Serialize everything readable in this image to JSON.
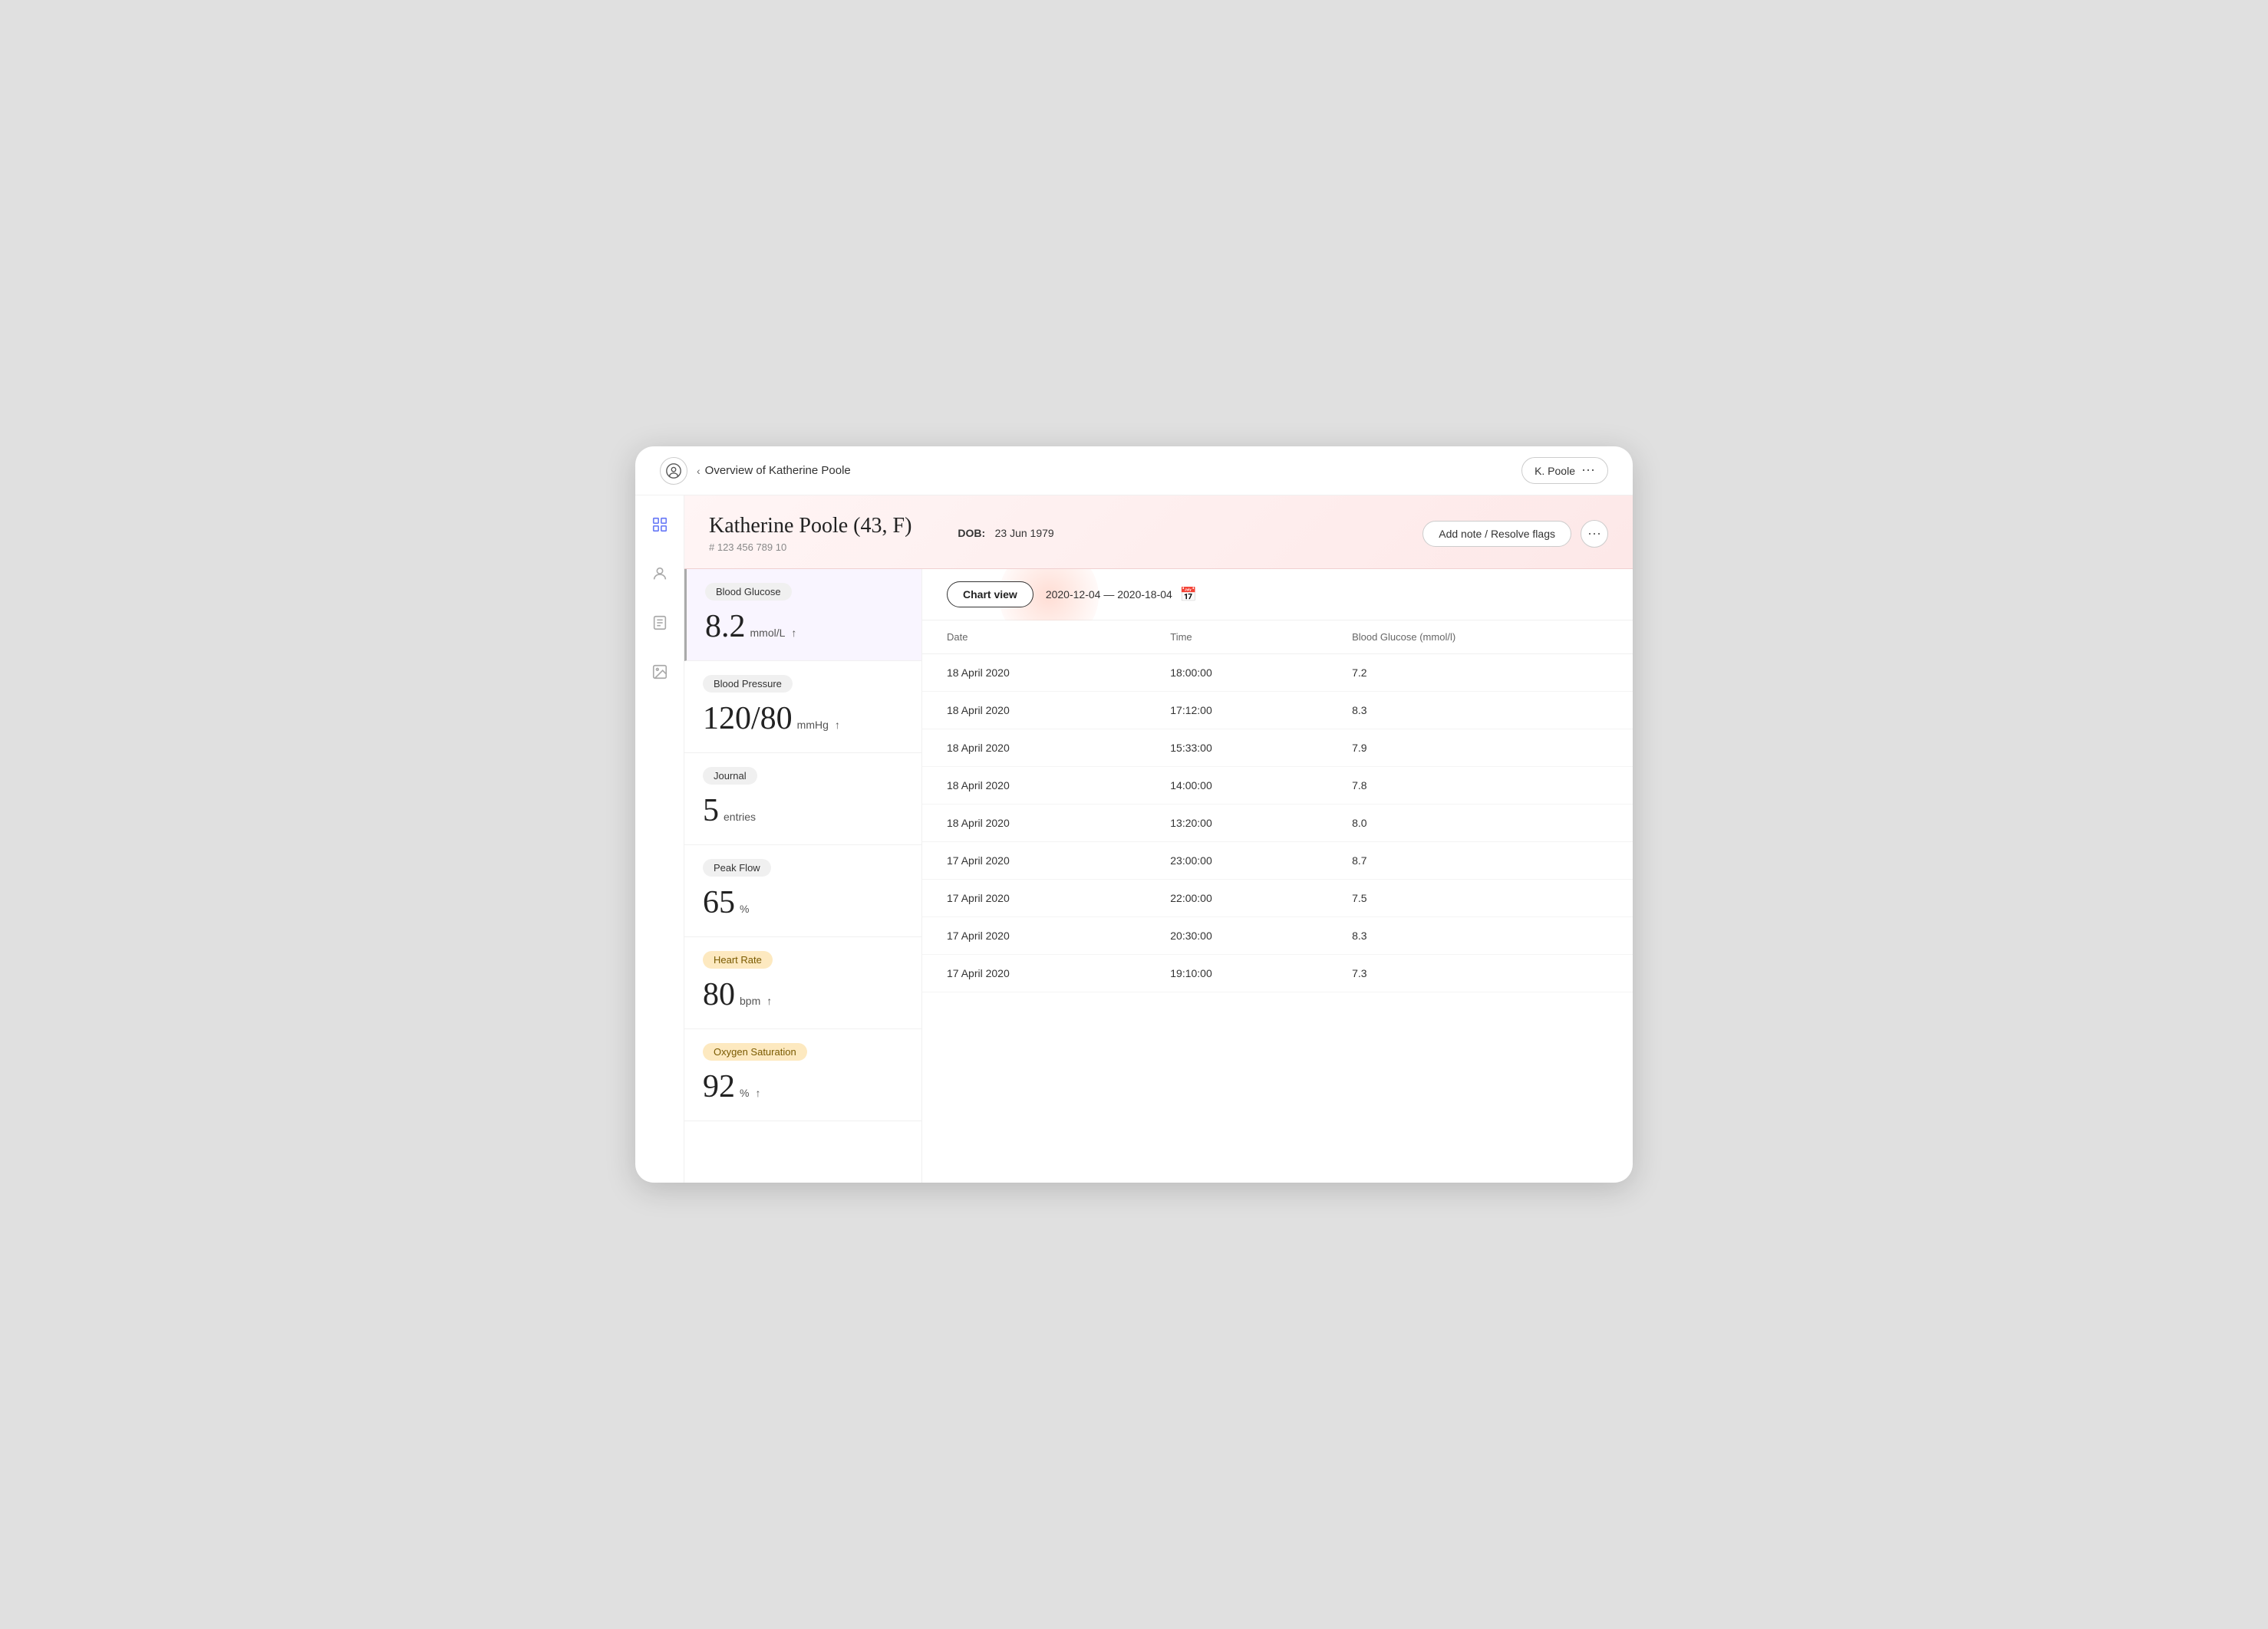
{
  "topBar": {
    "backLabel": "Overview of Katherine Poole",
    "userLabel": "K. Poole"
  },
  "sidebar": {
    "icons": [
      {
        "name": "activity-icon",
        "symbol": "📊",
        "active": true
      },
      {
        "name": "person-icon",
        "symbol": "👤",
        "active": false
      },
      {
        "name": "notes-icon",
        "symbol": "📋",
        "active": false
      },
      {
        "name": "gallery-icon",
        "symbol": "🖼️",
        "active": false
      }
    ]
  },
  "patient": {
    "name": "Katherine Poole (43,  F)",
    "id": "# 123 456 789 10",
    "dobLabel": "DOB:",
    "dobValue": "23 Jun 1979",
    "addNoteLabel": "Add note / Resolve flags",
    "moreLabel": "···"
  },
  "chartControls": {
    "chartViewLabel": "Chart view",
    "dateRange": "2020-12-04 — 2020-18-04"
  },
  "metrics": [
    {
      "id": "blood-glucose",
      "badge": "Blood Glucose",
      "badgeClass": "",
      "bigVal": "8.2",
      "unit": "mmol/L",
      "trend": "↑",
      "active": true
    },
    {
      "id": "blood-pressure",
      "badge": "Blood Pressure",
      "badgeClass": "",
      "bigVal": "120/80",
      "unit": "mmHg",
      "trend": "↑",
      "active": false
    },
    {
      "id": "journal",
      "badge": "Journal",
      "badgeClass": "",
      "bigVal": "5",
      "unit": "entries",
      "trend": "",
      "active": false
    },
    {
      "id": "peak-flow",
      "badge": "Peak Flow",
      "badgeClass": "",
      "bigVal": "65",
      "unit": "%",
      "trend": "",
      "active": false
    },
    {
      "id": "heart-rate",
      "badge": "Heart Rate",
      "badgeClass": "warn",
      "bigVal": "80",
      "unit": "bpm",
      "trend": "↑",
      "active": false
    },
    {
      "id": "oxygen-saturation",
      "badge": "Oxygen Saturation",
      "badgeClass": "warn",
      "bigVal": "92",
      "unit": "%",
      "trend": "↑",
      "active": false
    }
  ],
  "table": {
    "columns": [
      "Date",
      "Time",
      "Blood Glucose (mmol/l)"
    ],
    "rows": [
      {
        "date": "18 April 2020",
        "time": "18:00:00",
        "value": "7.2"
      },
      {
        "date": "18 April 2020",
        "time": "17:12:00",
        "value": "8.3"
      },
      {
        "date": "18 April 2020",
        "time": "15:33:00",
        "value": "7.9"
      },
      {
        "date": "18 April 2020",
        "time": "14:00:00",
        "value": "7.8"
      },
      {
        "date": "18 April 2020",
        "time": "13:20:00",
        "value": "8.0"
      },
      {
        "date": "17 April 2020",
        "time": "23:00:00",
        "value": "8.7"
      },
      {
        "date": "17 April 2020",
        "time": "22:00:00",
        "value": "7.5"
      },
      {
        "date": "17 April 2020",
        "time": "20:30:00",
        "value": "8.3"
      },
      {
        "date": "17 April 2020",
        "time": "19:10:00",
        "value": "7.3"
      }
    ]
  }
}
